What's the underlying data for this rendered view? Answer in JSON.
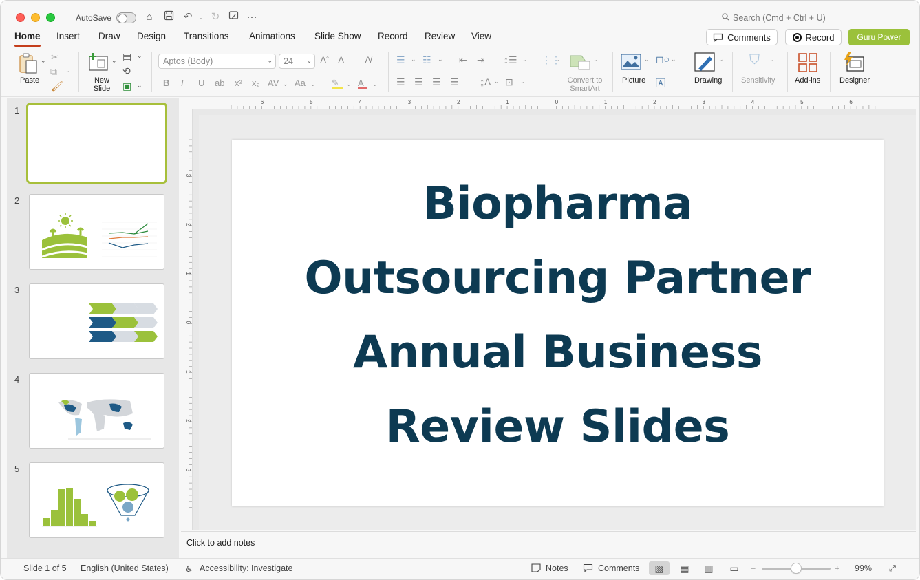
{
  "titlebar": {
    "autosave_label": "AutoSave",
    "search_placeholder": "Search (Cmd + Ctrl + U)"
  },
  "tabs": [
    {
      "label": "Home"
    },
    {
      "label": "Insert"
    },
    {
      "label": "Draw"
    },
    {
      "label": "Design"
    },
    {
      "label": "Transitions"
    },
    {
      "label": "Animations"
    },
    {
      "label": "Slide Show"
    },
    {
      "label": "Record"
    },
    {
      "label": "Review"
    },
    {
      "label": "View"
    }
  ],
  "header_buttons": {
    "comments": "Comments",
    "record": "Record",
    "guru": "Guru Power"
  },
  "ribbon": {
    "paste": "Paste",
    "new_slide": "New Slide",
    "font_name": "Aptos (Body)",
    "font_size": "24",
    "convert_smartart": "Convert to SmartArt",
    "picture": "Picture",
    "drawing": "Drawing",
    "sensitivity": "Sensitivity",
    "addins": "Add-ins",
    "designer": "Designer"
  },
  "thumbnails": [
    {
      "number": "1"
    },
    {
      "number": "2"
    },
    {
      "number": "3"
    },
    {
      "number": "4"
    },
    {
      "number": "5"
    }
  ],
  "slide": {
    "title_lines": [
      "Biopharma",
      "Outsourcing Partner",
      "Annual Business",
      "Review Slides"
    ]
  },
  "notes": {
    "placeholder": "Click to add notes"
  },
  "status": {
    "slide_counter": "Slide 1 of 5",
    "language": "English (United States)",
    "accessibility": "Accessibility: Investigate",
    "notes": "Notes",
    "comments": "Comments",
    "zoom": "99%"
  },
  "ruler": {
    "h_ticks": [
      "6",
      "5",
      "4",
      "3",
      "2",
      "1",
      "0",
      "1",
      "2",
      "3",
      "4",
      "5",
      "6"
    ],
    "v_ticks": [
      "3",
      "2",
      "1",
      "0",
      "1",
      "2",
      "3"
    ]
  },
  "colors": {
    "accent_tab": "#c43e1c",
    "brand_green": "#9bc13b",
    "title_navy": "#0d3a52"
  }
}
